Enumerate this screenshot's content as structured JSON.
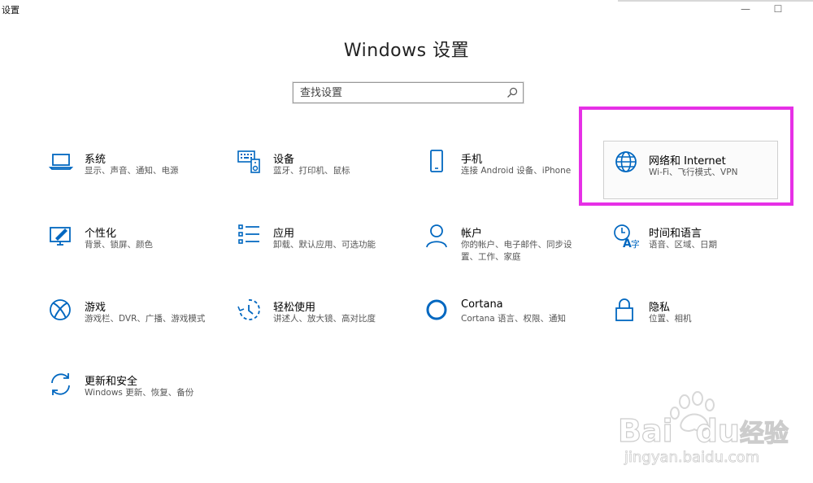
{
  "window": {
    "title": "设置",
    "minimize_glyph": "—",
    "maximize_glyph": "☐"
  },
  "header": {
    "title": "Windows 设置"
  },
  "search": {
    "placeholder": "查找设置",
    "icon": "search-icon"
  },
  "tiles": [
    {
      "id": "system",
      "name": "系统",
      "desc": "显示、声音、通知、电源",
      "icon": "laptop-icon"
    },
    {
      "id": "devices",
      "name": "设备",
      "desc": "蓝牙、打印机、鼠标",
      "icon": "keyboard-speaker-icon"
    },
    {
      "id": "phone",
      "name": "手机",
      "desc": "连接 Android 设备、iPhone",
      "icon": "phone-icon"
    },
    {
      "id": "network",
      "name": "网络和 Internet",
      "desc": "Wi-Fi、飞行模式、VPN",
      "icon": "globe-icon",
      "selected": true
    },
    {
      "id": "personalization",
      "name": "个性化",
      "desc": "背景、锁屏、颜色",
      "icon": "paint-screen-icon"
    },
    {
      "id": "apps",
      "name": "应用",
      "desc": "卸载、默认应用、可选功能",
      "icon": "app-list-icon"
    },
    {
      "id": "accounts",
      "name": "帐户",
      "desc": "你的帐户、电子邮件、同步设置、工作、家庭",
      "icon": "person-icon"
    },
    {
      "id": "time",
      "name": "时间和语言",
      "desc": "语音、区域、日期",
      "icon": "clock-language-icon"
    },
    {
      "id": "gaming",
      "name": "游戏",
      "desc": "游戏栏、DVR、广播、游戏模式",
      "icon": "xbox-icon"
    },
    {
      "id": "ease",
      "name": "轻松使用",
      "desc": "讲述人、放大镜、高对比度",
      "icon": "ease-of-access-icon"
    },
    {
      "id": "cortana",
      "name": "Cortana",
      "desc": "Cortana 语言、权限、通知",
      "icon": "cortana-circle-icon"
    },
    {
      "id": "privacy",
      "name": "隐私",
      "desc": "位置、相机",
      "icon": "lock-icon"
    },
    {
      "id": "update",
      "name": "更新和安全",
      "desc": "Windows 更新、恢复、备份",
      "icon": "refresh-icon"
    }
  ],
  "watermark": {
    "brand": "Bai",
    "brand2": "du",
    "suffix": "经验",
    "url": "jingyan.baidu.com"
  },
  "colors": {
    "accent": "#0067c0",
    "highlight": "#e630e6"
  }
}
